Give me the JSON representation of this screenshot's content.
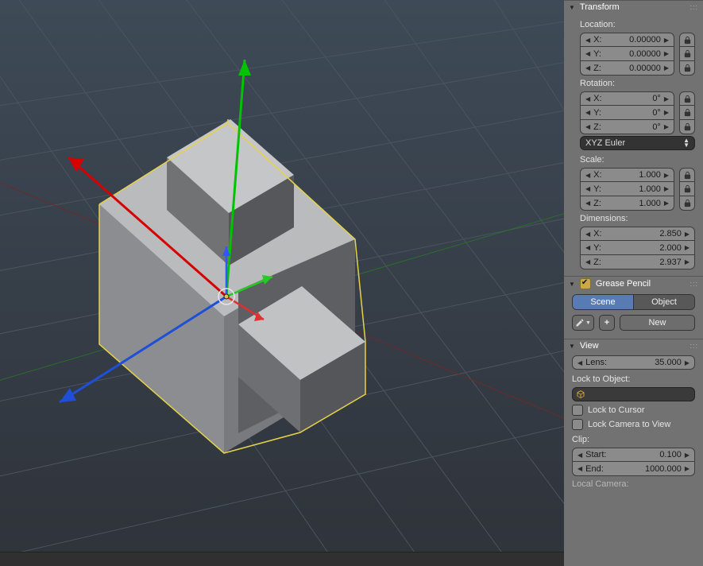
{
  "panels": {
    "transform": {
      "title": "Transform",
      "location_label": "Location:",
      "rotation_label": "Rotation:",
      "scale_label": "Scale:",
      "dimensions_label": "Dimensions:",
      "axes": {
        "x": "X:",
        "y": "Y:",
        "z": "Z:"
      },
      "location": {
        "x": "0.00000",
        "y": "0.00000",
        "z": "0.00000"
      },
      "rotation": {
        "x": "0°",
        "y": "0°",
        "z": "0°"
      },
      "rotation_mode": "XYZ Euler",
      "scale": {
        "x": "1.000",
        "y": "1.000",
        "z": "1.000"
      },
      "dimensions": {
        "x": "2.850",
        "y": "2.000",
        "z": "2.937"
      }
    },
    "grease": {
      "title": "Grease Pencil",
      "tab_scene": "Scene",
      "tab_object": "Object",
      "new": "New"
    },
    "view": {
      "title": "View",
      "lens_label": "Lens:",
      "lens_value": "35.000",
      "lock_object_label": "Lock to Object:",
      "lock_cursor": "Lock to Cursor",
      "lock_camera": "Lock Camera to View",
      "clip_label": "Clip:",
      "clip_start_label": "Start:",
      "clip_start": "0.100",
      "clip_end_label": "End:",
      "clip_end": "1000.000",
      "local_camera_label": "Local Camera:"
    }
  },
  "viewport": {
    "object_selected": true,
    "colors": {
      "axis_x": "#d43a3a",
      "axis_y": "#3ad43a",
      "axis_z": "#3a6ad4",
      "select_outline": "#e6d24a"
    }
  }
}
